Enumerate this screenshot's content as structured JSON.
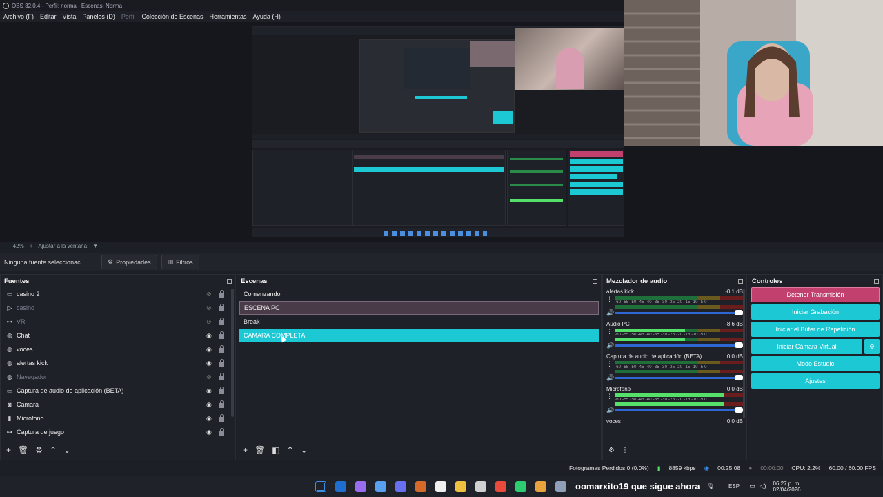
{
  "window": {
    "title": "OBS 32.0.4 - Perfil: norma - Escenas: Norma"
  },
  "menu": {
    "items": [
      "Archivo (F)",
      "Editar",
      "Vista",
      "Paneles (D)",
      "Perfil",
      "Colección de Escenas",
      "Herramientas",
      "Ayuda (H)"
    ]
  },
  "zoom": {
    "minus": "−",
    "value": "42%",
    "plus": "+",
    "fit": "Ajustar a la ventana"
  },
  "source_bar": {
    "no_source": "Ninguna fuente seleccionac",
    "properties": "Propiedades",
    "filters": "Filtros"
  },
  "sources": {
    "title": "Fuentes",
    "items": [
      {
        "label": "casino 2",
        "icon": "monitor-icon",
        "visible": false,
        "dim": false
      },
      {
        "label": "casino",
        "icon": "play-icon",
        "visible": false,
        "dim": true
      },
      {
        "label": "VR",
        "icon": "gamepad-icon",
        "visible": false,
        "dim": true
      },
      {
        "label": "Chat",
        "icon": "globe-icon",
        "visible": true,
        "dim": false
      },
      {
        "label": "voces",
        "icon": "globe-icon",
        "visible": true,
        "dim": false
      },
      {
        "label": "alertas kick",
        "icon": "globe-icon",
        "visible": true,
        "dim": false
      },
      {
        "label": "Navegador",
        "icon": "globe-icon",
        "visible": false,
        "dim": true
      },
      {
        "label": "Captura de audio de aplicación (BETA)",
        "icon": "monitor-icon",
        "visible": true,
        "dim": false
      },
      {
        "label": "Camara",
        "icon": "camera-icon",
        "visible": true,
        "dim": false
      },
      {
        "label": "Microfono",
        "icon": "microphone-icon",
        "visible": true,
        "dim": false
      },
      {
        "label": "Captura de juego",
        "icon": "gamepad-icon",
        "visible": true,
        "dim": false
      }
    ]
  },
  "scenes": {
    "title": "Escenas",
    "items": [
      "Comenzando",
      "ESCENA PC",
      "Break",
      "CAMARA COMPLETA"
    ]
  },
  "mixer": {
    "title": "Mezclador de audio",
    "scale": "-60 -55 -50 -45 -40 -35 -30 -25 -20 -15 -10 -5 0",
    "channels": [
      {
        "name": "alertas kick",
        "db": "-0.1 dB",
        "level": 0.0
      },
      {
        "name": "Audio PC",
        "db": "-8.6 dB",
        "level": 0.55
      },
      {
        "name": "Captura de audio de aplicación (BETA)",
        "db": "0.0 dB",
        "level": 0.0
      },
      {
        "name": "Microfono",
        "db": "0.0 dB",
        "level": 0.85
      },
      {
        "name": "voces",
        "db": "0.0 dB",
        "level": 0.0
      }
    ]
  },
  "controls": {
    "title": "Controles",
    "stop_stream": "Detener Transmisión",
    "start_recording": "Iniciar Grabación",
    "start_replay": "Iniciar el Búfer de Repetición",
    "start_vcam": "Iniciar Cámara Virtual",
    "studio_mode": "Modo Estudio",
    "settings": "Ajustes"
  },
  "status": {
    "dropped": "Fotogramas Perdidos 0 (0.0%)",
    "bitrate": "8859 kbps",
    "stream_time": "00:25:08",
    "rec_time": "00:00:00",
    "cpu": "CPU: 2.2%",
    "fps": "60.00 / 60.00 FPS"
  },
  "taskbar": {
    "overlay_text": "oomarxito19 que sigue ahora",
    "lang": "ESP",
    "time": "06:27 p. m.",
    "date": "02/04/2026",
    "icon_colors": [
      "#3b8fe8",
      "#1f6fd0",
      "#9a6cf0",
      "#5aa0f0",
      "#6870f0",
      "#d66a2a",
      "#f0f0f0",
      "#f0c040",
      "#d0d0d0",
      "#e84b3c",
      "#2ecc71",
      "#e8a33c",
      "#8fa0b8"
    ]
  },
  "colors": {
    "accent": "#1bc8d3",
    "stop": "#c2406e"
  }
}
